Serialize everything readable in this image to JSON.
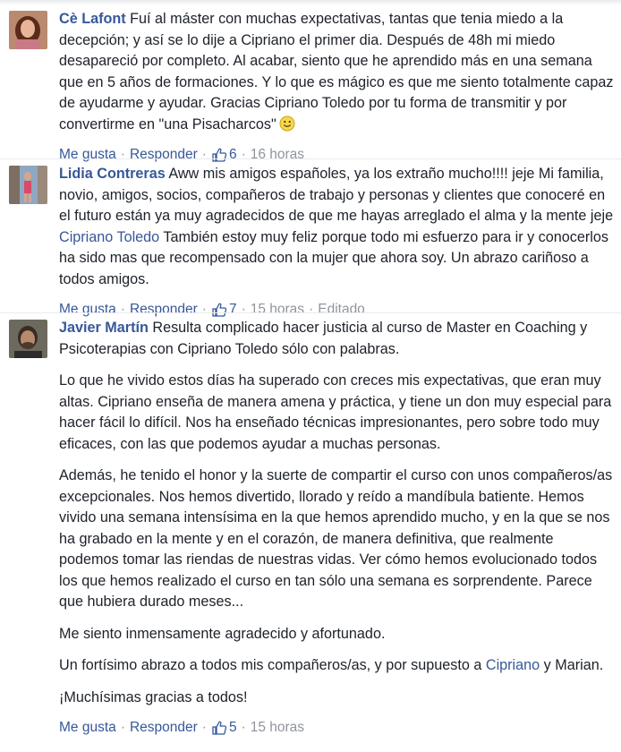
{
  "comments": [
    {
      "author": "Cè Lafont",
      "text_lines": [
        " Fuí al máster con muchas expectativas, tantas que tenia miedo a la decepción; y así se lo dije a Cipriano el primer dia. Después de 48h mi miedo desapareció por completo. Al acabar, siento que he aprendido más en una semana que en 5 años de formaciones. Y lo que es mágico es que me siento totalmente capaz de ayudarme y ayudar. Gracias Cipriano Toledo por tu forma de transmitir y por convertirme en \"una Pisacharcos\""
      ],
      "emoji": "smiley-emoji",
      "like_label": "Me gusta",
      "reply_label": "Responder",
      "likes": "6",
      "time": "16 horas"
    },
    {
      "author": "Lidia Contreras",
      "text_before_mention": " Aww mis amigos españoles, ya los extraño mucho!!!! jeje Mi familia, novio, amigos, socios, compañeros de trabajo y personas y clientes que conoceré en el futuro están ya muy agradecidos de que me hayas arreglado el alma y la mente jeje ",
      "mention": "Cipriano Toledo",
      "text_after_mention": " También estoy muy feliz porque todo mi esfuerzo para ir y conocerlos ha sido mas que recompensado con la mujer que ahora soy. Un abrazo cariñoso a todos amigos.",
      "like_label": "Me gusta",
      "reply_label": "Responder",
      "likes": "7",
      "time": "15 horas",
      "edited": "Editado"
    },
    {
      "author": "Javier Martín",
      "first_para": " Resulta complicado hacer justicia al curso de Master en Coaching y Psicoterapias con Cipriano Toledo sólo con palabras.",
      "para2": "Lo que he vivido estos días ha superado con creces mis expectativas, que eran muy altas. Cipriano enseña de manera amena y práctica, y tiene un don muy especial para hacer fácil lo difícil. Nos ha enseñado técnicas impresionantes, pero sobre todo muy eficaces, con las que podemos ayudar a muchas personas.",
      "para3": "Además, he tenido el honor y la suerte de compartir el curso con unos compañeros/as excepcionales. Nos hemos divertido, llorado y reído a mandíbula batiente. Hemos vivido una semana intensísima en la que hemos aprendido mucho, y en la que se nos ha grabado en la mente y en el corazón, de manera definitiva, que realmente podemos tomar las riendas de nuestras vidas. Ver cómo hemos evolucionado todos los que hemos realizado el curso en tan sólo una semana es sorprendente. Parece que hubiera durado meses...",
      "para4": "Me siento inmensamente agradecido y afortunado.",
      "para5_before": "Un fortísimo abrazo a todos mis compañeros/as, y por supuesto a ",
      "para5_mention": "Cipriano",
      "para5_after": " y Marian.",
      "para6": "¡Muchísimas gracias a todos!",
      "like_label": "Me gusta",
      "reply_label": "Responder",
      "likes": "5",
      "time": "15 horas"
    }
  ],
  "separator": "·",
  "colors": {
    "link": "#365899",
    "meta": "#90949c",
    "text": "#1d2129"
  }
}
